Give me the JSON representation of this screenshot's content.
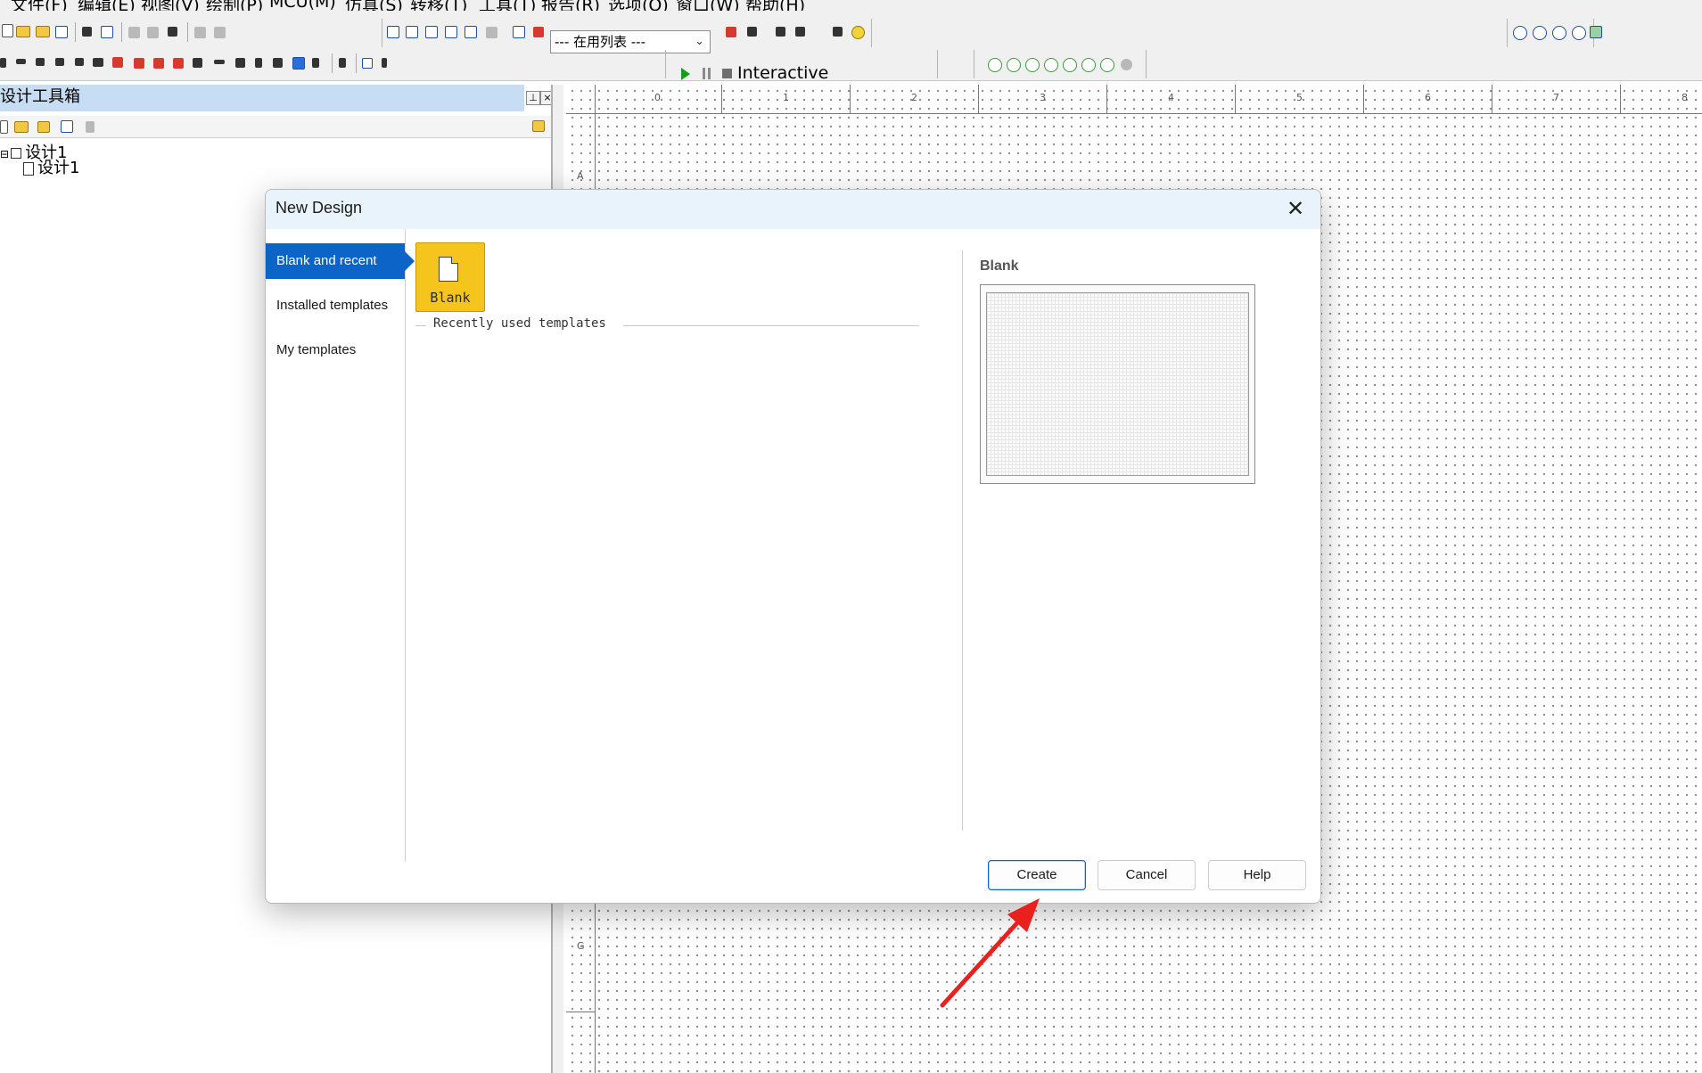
{
  "menu": {
    "items": [
      "文件(F)",
      "编辑(E)",
      "视图(V)",
      "绘制(P)",
      "MCU(M)",
      "仿真(S)",
      "转移(T)",
      "工具(T)",
      "报告(R)",
      "选项(O)",
      "窗口(W)",
      "帮助(H)"
    ]
  },
  "toolbar": {
    "list_combo_value": "--- 在用列表 ---",
    "sim_mode_label": "Interactive"
  },
  "toolbox": {
    "title": "设计工具箱",
    "tree": {
      "root": "设计1",
      "child": "设计1"
    }
  },
  "canvas": {
    "ruler_numbers": [
      "0",
      "1",
      "2",
      "3",
      "4",
      "5",
      "6",
      "7",
      "8"
    ],
    "ruler_letters": [
      "A",
      "G"
    ]
  },
  "dialog": {
    "title": "New Design",
    "close_glyph": "✕",
    "nav": {
      "items": [
        "Blank and recent",
        "Installed templates",
        "My templates"
      ],
      "selected_index": 0
    },
    "tiles": {
      "blank_label": "Blank"
    },
    "recent_section_label": "Recently used templates",
    "preview": {
      "title": "Blank"
    },
    "buttons": {
      "create": "Create",
      "cancel": "Cancel",
      "help": "Help"
    }
  },
  "colors": {
    "accent": "#0c64c8",
    "tile": "#f5c51d",
    "arrow": "#e8201e",
    "toolbox_header": "#c7ddf3",
    "dialog_titlebar": "#e8f3fb"
  },
  "icons": {
    "annotation": "red-arrow-pointing-to-create-icon",
    "blank_tile": "blank-document-icon",
    "close": "close-icon"
  }
}
